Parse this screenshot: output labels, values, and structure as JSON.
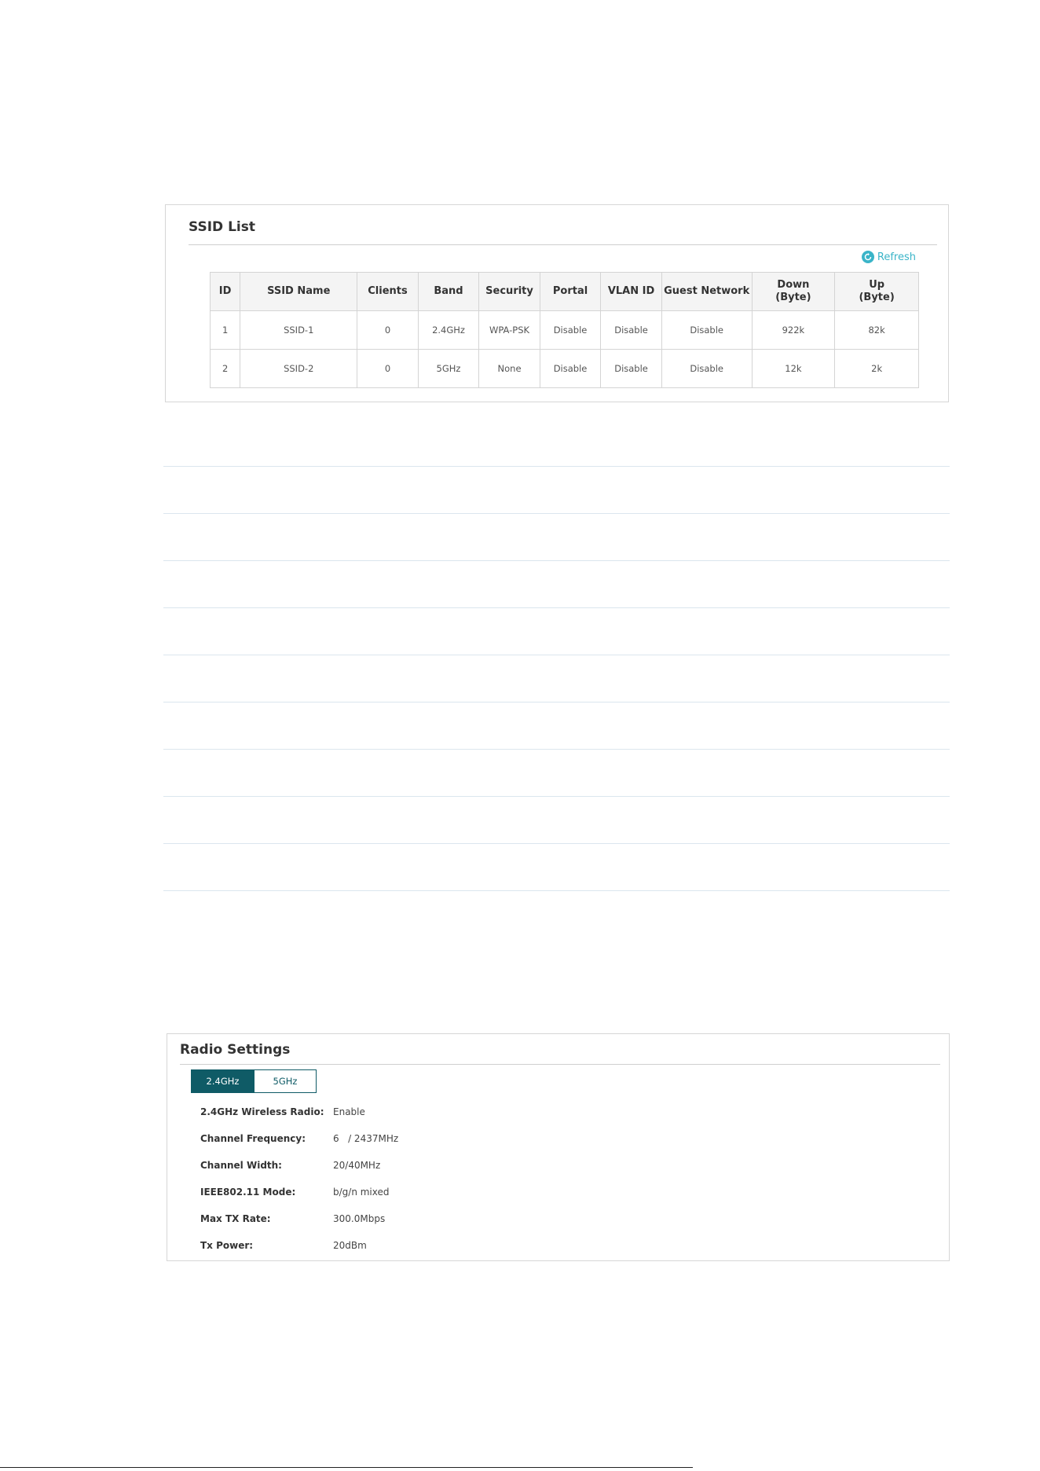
{
  "ssid_list": {
    "title": "SSID List",
    "refresh_label": "Refresh",
    "refresh_icon": "refresh-icon",
    "columns": [
      "ID",
      "SSID Name",
      "Clients",
      "Band",
      "Security",
      "Portal",
      "VLAN ID",
      "Guest Network",
      "Down\n(Byte)",
      "Up\n(Byte)"
    ],
    "rows": [
      [
        "1",
        "SSID-1",
        "0",
        "2.4GHz",
        "WPA-PSK",
        "Disable",
        "Disable",
        "Disable",
        "922k",
        "82k"
      ],
      [
        "2",
        "SSID-2",
        "0",
        "5GHz",
        "None",
        "Disable",
        "Disable",
        "Disable",
        "12k",
        "2k"
      ]
    ]
  },
  "radio_settings": {
    "title": "Radio Settings",
    "tabs": [
      {
        "label": "2.4GHz",
        "active": true
      },
      {
        "label": "5GHz",
        "active": false
      }
    ],
    "fields": [
      {
        "label": "2.4GHz Wireless Radio:",
        "value": "Enable"
      },
      {
        "label": "Channel Frequency:",
        "value": "6   / 2437MHz"
      },
      {
        "label": "Channel Width:",
        "value": "20/40MHz"
      },
      {
        "label": "IEEE802.11 Mode:",
        "value": "b/g/n mixed"
      },
      {
        "label": "Max TX Rate:",
        "value": "300.0Mbps"
      },
      {
        "label": "Tx Power:",
        "value": "20dBm"
      }
    ]
  },
  "colors": {
    "accent": "#0f5b66",
    "link": "#3ab4c8",
    "divider": "#dbe6ee"
  }
}
